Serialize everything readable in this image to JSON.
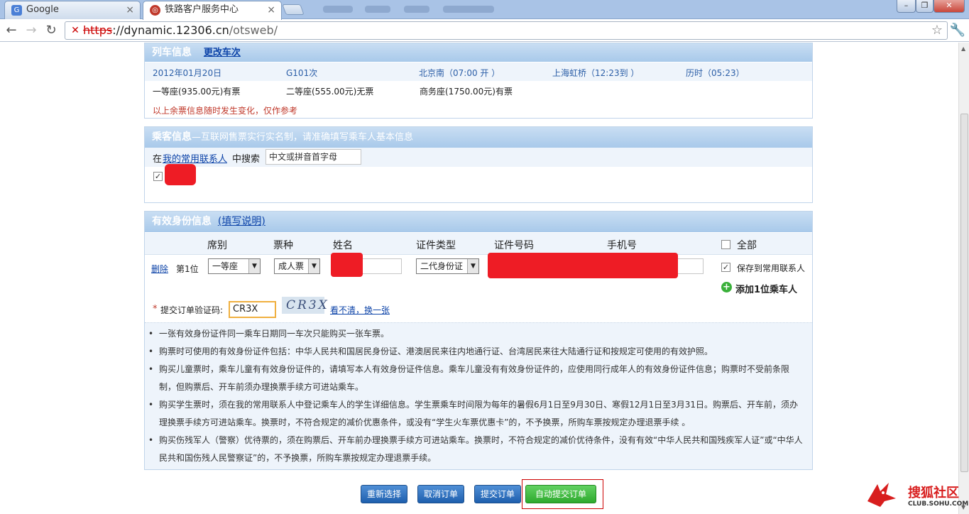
{
  "browser": {
    "tabs": [
      {
        "title": "Google",
        "icon": "google-favicon"
      },
      {
        "title": "铁路客户服务中心",
        "icon": "railway-favicon"
      }
    ],
    "tab_close": "×",
    "url_protocol": "https",
    "url_host": "://dynamic.12306.cn",
    "url_path": "/otsweb/",
    "window_buttons": [
      "–",
      "❐",
      "✕"
    ]
  },
  "train_info": {
    "header": "列车信息",
    "change_link": "更改车次",
    "date": "2012年01月20日",
    "train_no": "G101次",
    "depart": "北京南（07:00 开 ）",
    "arrive": "上海虹桥（12:23到 ）",
    "duration": "历时（05:23）",
    "seats": [
      "一等座(935.00元)有票",
      "二等座(555.00元)无票",
      "商务座(1750.00元)有票"
    ],
    "notice": "以上余票信息随时发生变化，仅作参考"
  },
  "passenger_info": {
    "header": "乘客信息",
    "subheader": "—互联网售票实行实名制，请准确填写乘车人基本信息",
    "search_prefix": "在",
    "search_link": "我的常用联系人",
    "search_suffix": "中搜索",
    "search_placeholder": "中文或拼音首字母"
  },
  "id_info": {
    "header": "有效身份信息",
    "help_link": "(填写说明)",
    "columns": [
      "席别",
      "票种",
      "姓名",
      "证件类型",
      "证件号码",
      "手机号"
    ],
    "select_all": "全部",
    "row": {
      "delete": "删除",
      "position": "第1位",
      "seat": "一等座",
      "ticket_type": "成人票",
      "id_type": "二代身份证",
      "save_contact": "保存到常用联系人"
    },
    "add_passenger": "添加1位乘车人",
    "captcha_label": "提交订单验证码:",
    "captcha_value": "CR3X",
    "captcha_image_text": "CR3X",
    "captcha_refresh": "看不清，换一张"
  },
  "notes": [
    "一张有效身份证件同一乘车日期同一车次只能购买一张车票。",
    "购票时可使用的有效身份证件包括：中华人民共和国居民身份证、港澳居民来往内地通行证、台湾居民来往大陆通行证和按规定可使用的有效护照。",
    "购买儿童票时，乘车儿童有有效身份证件的，请填写本人有效身份证件信息。乘车儿童没有有效身份证件的，应使用同行成年人的有效身份证件信息；购票时不受前条限制，但购票后、开车前须办理换票手续方可进站乘车。",
    "购买学生票时，须在我的常用联系人中登记乘车人的学生详细信息。学生票乘车时间限为每年的暑假6月1日至9月30日、寒假12月1日至3月31日。购票后、开车前，须办理换票手续方可进站乘车。换票时，不符合规定的减价优惠条件，或没有“学生火车票优惠卡”的，不予换票，所购车票按规定办理退票手续 。",
    "购买伤残军人（警察）优待票的，须在购票后、开车前办理换票手续方可进站乘车。换票时，不符合规定的减价优待条件，没有有效“中华人民共和国残疾军人证”或“中华人民共和国伤残人民警察证”的，不予换票，所购车票按规定办理退票手续。"
  ],
  "buttons": {
    "reselect": "重新选择",
    "cancel": "取消订单",
    "submit": "提交订单",
    "auto_submit": "自动提交订单"
  },
  "watermark": {
    "brand": "搜狐社区",
    "domain": "CLUB.SOHU.COM"
  },
  "colors": {
    "header_blue": "#a8c9ea",
    "redaction": "#ee1c25",
    "auto_submit_green": "#2eaa2e"
  }
}
